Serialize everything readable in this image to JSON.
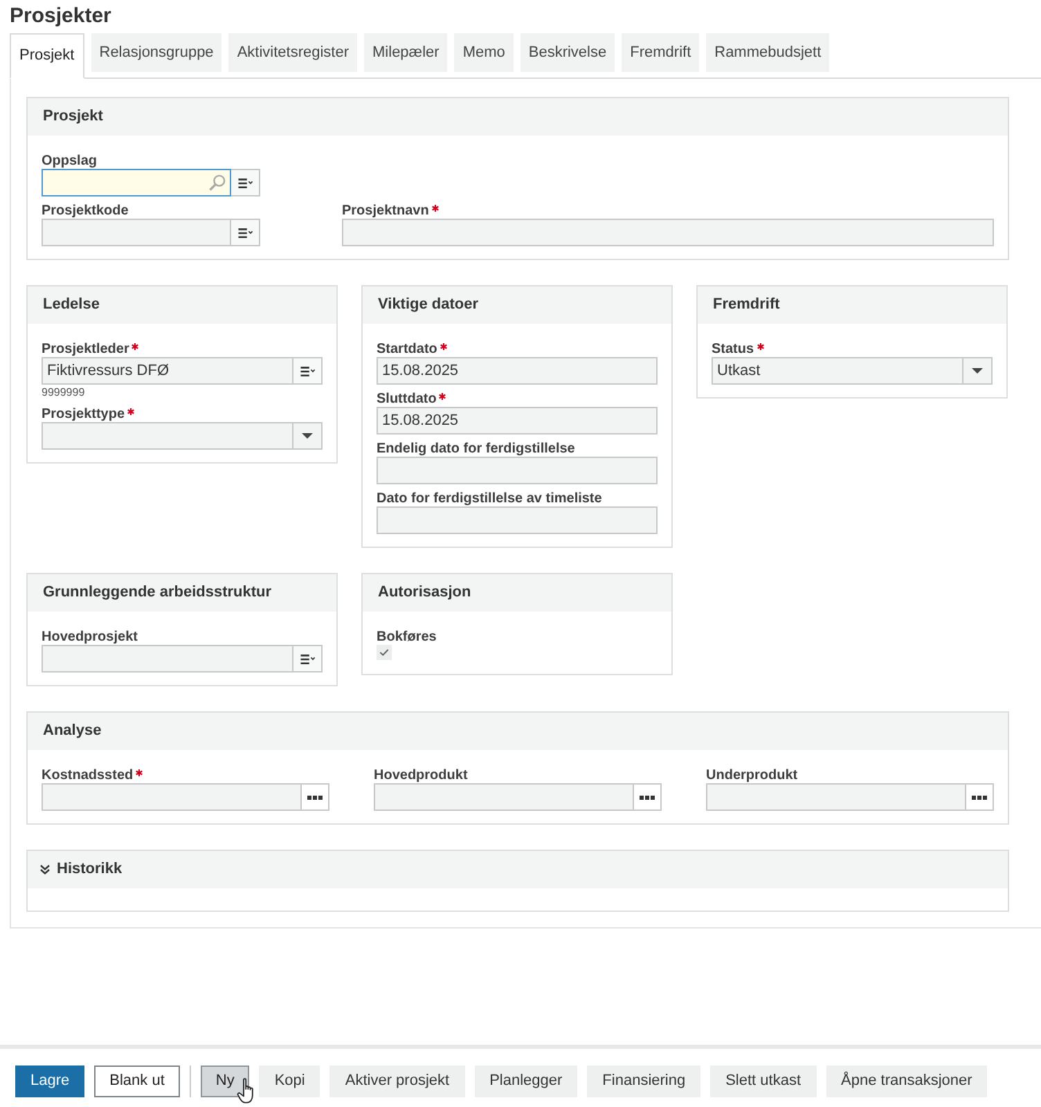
{
  "page_title": "Prosjekter",
  "tabs": [
    {
      "label": "Prosjekt",
      "selected": true
    },
    {
      "label": "Relasjonsgruppe",
      "selected": false
    },
    {
      "label": "Aktivitetsregister",
      "selected": false
    },
    {
      "label": "Milepæler",
      "selected": false
    },
    {
      "label": "Memo",
      "selected": false
    },
    {
      "label": "Beskrivelse",
      "selected": false
    },
    {
      "label": "Fremdrift",
      "selected": false
    },
    {
      "label": "Rammebudsjett",
      "selected": false
    }
  ],
  "section_rows": [
    [
      {
        "title": "Prosjekt",
        "field_rows": [
          [
            {
              "kind": "lookup",
              "label": "Oppslag",
              "required": false,
              "focused": true
            }
          ],
          [
            {
              "kind": "list",
              "label": "Prosjektkode",
              "required": false,
              "focused": false
            },
            {
              "kind": "text",
              "label": "Prosjektnavn",
              "required": true,
              "focused": false
            }
          ]
        ]
      }
    ],
    [
      {
        "title": "Ledelse",
        "field_rows": [
          [
            {
              "kind": "list",
              "label": "Prosjektleder",
              "required": true,
              "focused": false,
              "value": "Fiktivressurs DFØ",
              "note": "9999999"
            }
          ],
          [
            {
              "kind": "select",
              "label": "Prosjekttype",
              "required": true,
              "focused": false
            }
          ]
        ]
      },
      {
        "title": "Viktige datoer",
        "field_rows": [
          [
            {
              "kind": "date",
              "label": "Startdato",
              "required": true,
              "focused": false,
              "value": "15.08.2025"
            }
          ],
          [
            {
              "kind": "date",
              "label": "Sluttdato",
              "required": true,
              "focused": false,
              "value": "15.08.2025"
            }
          ],
          [
            {
              "kind": "date",
              "label": "Endelig dato for ferdigstillelse",
              "required": false,
              "focused": false
            }
          ],
          [
            {
              "kind": "date",
              "label": "Dato for ferdigstillelse av timeliste",
              "required": false,
              "focused": false
            }
          ]
        ]
      },
      {
        "title": "Fremdrift",
        "field_rows": [
          [
            {
              "kind": "select",
              "label": "Status",
              "required": true,
              "focused": false,
              "value": "Utkast"
            }
          ]
        ]
      }
    ],
    [
      {
        "title": "Grunnleggende arbeidsstruktur",
        "field_rows": [
          [
            {
              "kind": "list",
              "label": "Hovedprosjekt",
              "required": false,
              "focused": false
            }
          ]
        ]
      },
      {
        "title": "Autorisasjon",
        "field_rows": [
          [
            {
              "kind": "checkbox",
              "label": "Bokføres",
              "required": false,
              "focused": false,
              "checked": true
            }
          ]
        ]
      }
    ],
    [
      {
        "title": "Analyse",
        "field_rows": [
          [
            {
              "kind": "ellipsis",
              "label": "Kostnadssted",
              "required": true,
              "focused": false
            },
            {
              "kind": "ellipsis",
              "label": "Hovedprodukt",
              "required": false,
              "focused": false
            },
            {
              "kind": "ellipsis",
              "label": "Underprodukt",
              "required": false,
              "focused": false
            }
          ]
        ]
      }
    ]
  ],
  "history": {
    "title": "Historikk",
    "expanded": false
  },
  "actions": [
    {
      "label": "Lagre",
      "kind": "primary",
      "hovered": false
    },
    {
      "label": "Blank ut",
      "kind": "outline",
      "hovered": false
    },
    {
      "label": "Ny",
      "kind": "plain",
      "hovered": true
    },
    {
      "label": "Kopi",
      "kind": "plain",
      "hovered": false
    },
    {
      "label": "Aktiver prosjekt",
      "kind": "plain",
      "hovered": false
    },
    {
      "label": "Planlegger",
      "kind": "plain",
      "hovered": false
    },
    {
      "label": "Finansiering",
      "kind": "plain",
      "hovered": false
    },
    {
      "label": "Slett utkast",
      "kind": "plain",
      "hovered": false
    },
    {
      "label": "Åpne transaksjoner",
      "kind": "plain",
      "hovered": false
    }
  ]
}
